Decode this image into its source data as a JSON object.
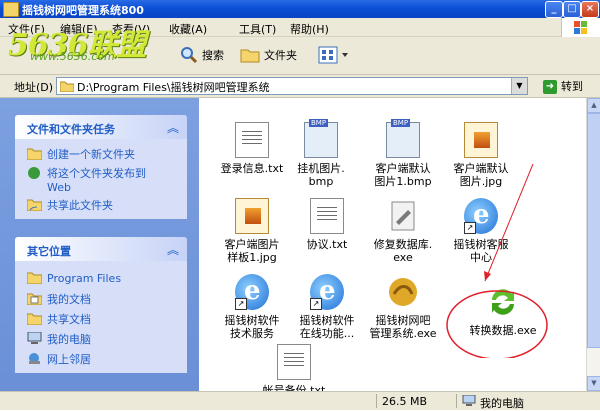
{
  "window": {
    "title": "摇钱树网吧管理系统800"
  },
  "menu": {
    "items": [
      "文件(F)",
      "编辑(E)",
      "查看(V)",
      "收藏(A)",
      "工具(T)",
      "帮助(H)"
    ]
  },
  "toolbar": {
    "search_label": "搜索",
    "folders_label": "文件夹"
  },
  "logo": {
    "brand": "5636联盟",
    "url": "www.5636.com"
  },
  "address": {
    "label": "地址(D)",
    "value": "D:\\Program Files\\摇钱树网吧管理系统",
    "go_label": "转到"
  },
  "tasks_panel": {
    "title": "文件和文件夹任务",
    "items": [
      {
        "label": "创建一个新文件夹",
        "icon": "new-folder-icon"
      },
      {
        "label": "将这个文件夹发布到",
        "label2": "Web",
        "icon": "publish-web-icon"
      },
      {
        "label": "共享此文件夹",
        "icon": "share-folder-icon"
      }
    ]
  },
  "places_panel": {
    "title": "其它位置",
    "items": [
      {
        "label": "Program Files",
        "icon": "folder-icon"
      },
      {
        "label": "我的文档",
        "icon": "documents-icon"
      },
      {
        "label": "共享文档",
        "icon": "shared-docs-icon"
      },
      {
        "label": "我的电脑",
        "icon": "computer-icon"
      },
      {
        "label": "网上邻居",
        "icon": "network-icon"
      }
    ]
  },
  "files": [
    {
      "name1": "登录信息.txt",
      "name2": "",
      "type": "txt"
    },
    {
      "name1": "挂机图片.",
      "name2": "bmp",
      "type": "bmp"
    },
    {
      "name1": "客户端默认",
      "name2": "图片1.bmp",
      "type": "bmp"
    },
    {
      "name1": "客户端默认",
      "name2": "图片.jpg",
      "type": "jpg"
    },
    {
      "name1": "客户端图片",
      "name2": "样板1.jpg",
      "type": "jpg"
    },
    {
      "name1": "协议.txt",
      "name2": "",
      "type": "txt"
    },
    {
      "name1": "修复数据库.",
      "name2": "exe",
      "type": "exe"
    },
    {
      "name1": "摇钱树客服",
      "name2": "中心",
      "type": "ie"
    },
    {
      "name1": "摇钱树软件",
      "name2": "技术服务",
      "type": "ie"
    },
    {
      "name1": "摇钱树软件",
      "name2": "在线功能...",
      "type": "ie"
    },
    {
      "name1": "摇钱树网吧",
      "name2": "管理系统.exe",
      "type": "dragon"
    },
    {
      "name1": "转换数据.exe",
      "name2": "",
      "type": "convert"
    },
    {
      "name1": "帐号备份.txt",
      "name2": "",
      "type": "txt"
    }
  ],
  "status": {
    "size": "26.5 MB",
    "location": "我的电脑"
  },
  "colors": {
    "titlebar": "#0b4fd6",
    "link": "#215dc6",
    "annotation": "#e0202a"
  }
}
